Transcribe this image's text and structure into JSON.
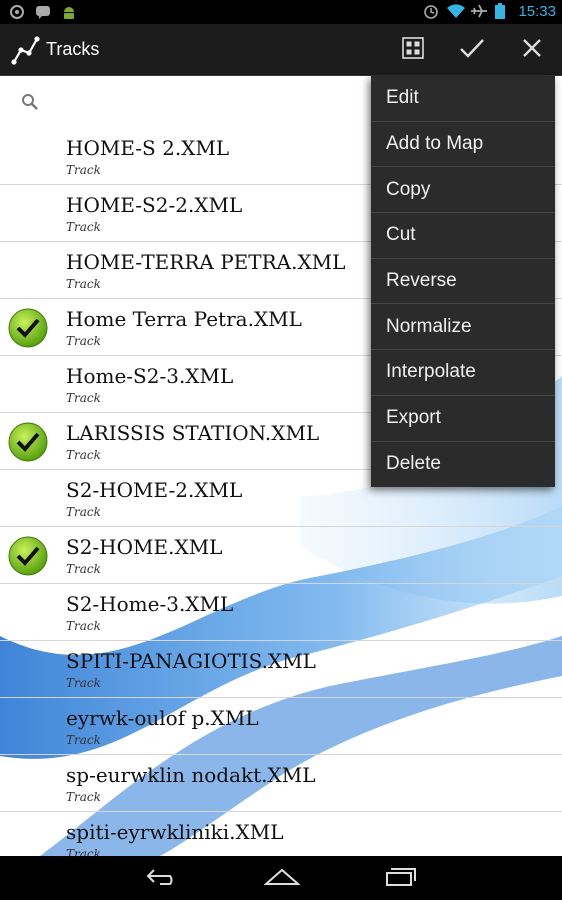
{
  "statusbar": {
    "time": "15:33"
  },
  "actionbar": {
    "title": "Tracks",
    "icons": [
      "track-icon",
      "grid-icon",
      "check-icon",
      "close-icon"
    ]
  },
  "search": {
    "placeholder": ""
  },
  "tracks": [
    {
      "name": "HOME-S 2.XML",
      "type": "Track",
      "checked": false
    },
    {
      "name": "HOME-S2-2.XML",
      "type": "Track",
      "checked": false
    },
    {
      "name": "HOME-TERRA PETRA.XML",
      "type": "Track",
      "checked": false
    },
    {
      "name": "Home Terra Petra.XML",
      "type": "Track",
      "checked": true
    },
    {
      "name": "Home-S2-3.XML",
      "type": "Track",
      "checked": false
    },
    {
      "name": "LARISSIS STATION.XML",
      "type": "Track",
      "checked": true
    },
    {
      "name": "S2-HOME-2.XML",
      "type": "Track",
      "checked": false
    },
    {
      "name": "S2-HOME.XML",
      "type": "Track",
      "checked": true
    },
    {
      "name": "S2-Home-3.XML",
      "type": "Track",
      "checked": false
    },
    {
      "name": "SPITI-PANAGIOTIS.XML",
      "type": "Track",
      "checked": false
    },
    {
      "name": "eyrwk-oulof p.XML",
      "type": "Track",
      "checked": false
    },
    {
      "name": "sp-eurwklin nodakt.XML",
      "type": "Track",
      "checked": false
    },
    {
      "name": "spiti-eyrwkliniki.XML",
      "type": "Track",
      "checked": false
    }
  ],
  "menu": {
    "items": [
      "Edit",
      "Add to Map",
      "Copy",
      "Cut",
      "Reverse",
      "Normalize",
      "Interpolate",
      "Export",
      "Delete"
    ]
  },
  "colors": {
    "accent": "#33b5e5",
    "check": "#7ac70c",
    "menu_bg": "#2b2b2b"
  }
}
